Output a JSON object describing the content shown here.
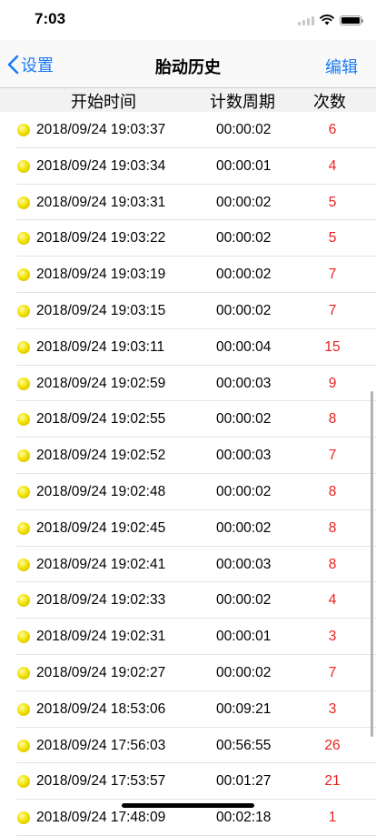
{
  "status_bar": {
    "time": "7:03"
  },
  "nav": {
    "back_label": "设置",
    "title": "胎动历史",
    "edit_label": "编辑"
  },
  "header": {
    "start_time": "开始时间",
    "period": "计数周期",
    "count": "次数"
  },
  "colors": {
    "accent": "#1a7cf5",
    "count_red": "#e8211f"
  },
  "rows": [
    {
      "date": "2018/09/24  19:03:37",
      "period": "00:00:02",
      "count": "6"
    },
    {
      "date": "2018/09/24  19:03:34",
      "period": "00:00:01",
      "count": "4"
    },
    {
      "date": "2018/09/24  19:03:31",
      "period": "00:00:02",
      "count": "5"
    },
    {
      "date": "2018/09/24  19:03:22",
      "period": "00:00:02",
      "count": "5"
    },
    {
      "date": "2018/09/24  19:03:19",
      "period": "00:00:02",
      "count": "7"
    },
    {
      "date": "2018/09/24  19:03:15",
      "period": "00:00:02",
      "count": "7"
    },
    {
      "date": "2018/09/24  19:03:11",
      "period": "00:00:04",
      "count": "15"
    },
    {
      "date": "2018/09/24  19:02:59",
      "period": "00:00:03",
      "count": "9"
    },
    {
      "date": "2018/09/24  19:02:55",
      "period": "00:00:02",
      "count": "8"
    },
    {
      "date": "2018/09/24  19:02:52",
      "period": "00:00:03",
      "count": "7"
    },
    {
      "date": "2018/09/24  19:02:48",
      "period": "00:00:02",
      "count": "8"
    },
    {
      "date": "2018/09/24  19:02:45",
      "period": "00:00:02",
      "count": "8"
    },
    {
      "date": "2018/09/24  19:02:41",
      "period": "00:00:03",
      "count": "8"
    },
    {
      "date": "2018/09/24  19:02:33",
      "period": "00:00:02",
      "count": "4"
    },
    {
      "date": "2018/09/24  19:02:31",
      "period": "00:00:01",
      "count": "3"
    },
    {
      "date": "2018/09/24  19:02:27",
      "period": "00:00:02",
      "count": "7"
    },
    {
      "date": "2018/09/24  18:53:06",
      "period": "00:09:21",
      "count": "3"
    },
    {
      "date": "2018/09/24  17:56:03",
      "period": "00:56:55",
      "count": "26"
    },
    {
      "date": "2018/09/24  17:53:57",
      "period": "00:01:27",
      "count": "21"
    },
    {
      "date": "2018/09/24  17:48:09",
      "period": "00:02:18",
      "count": "1"
    }
  ]
}
